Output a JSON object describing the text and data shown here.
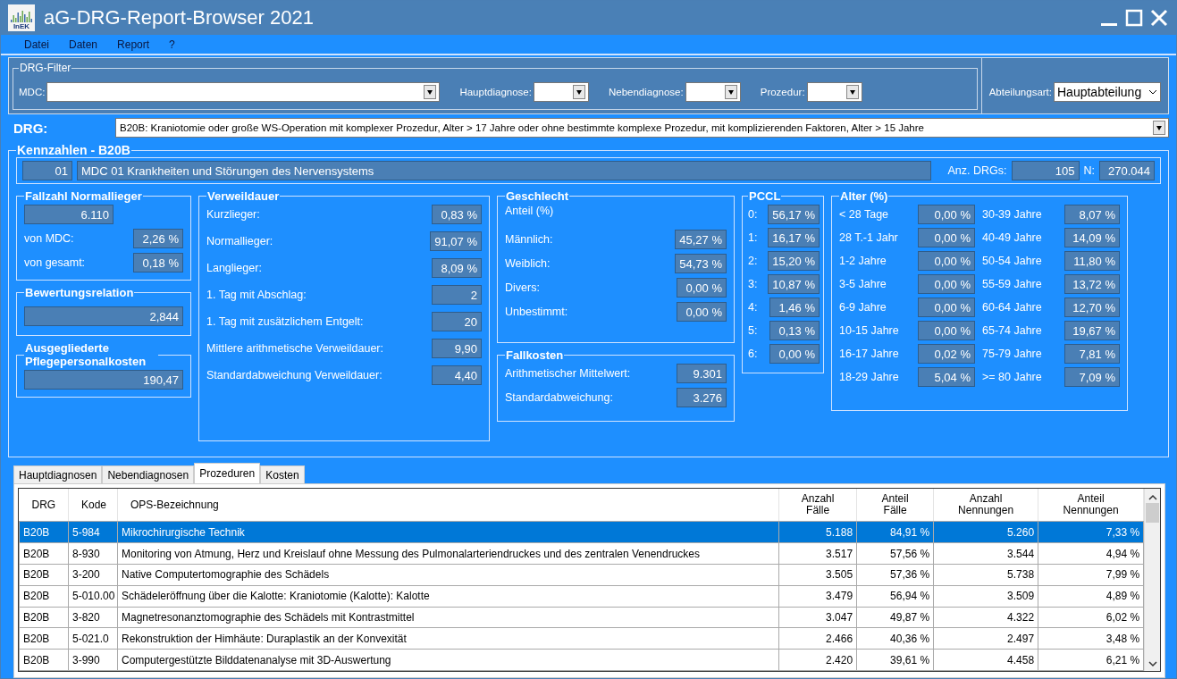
{
  "window": {
    "title": "aG-DRG-Report-Browser 2021",
    "logo_text": "InEK"
  },
  "menu": [
    "Datei",
    "Daten",
    "Report",
    "?"
  ],
  "filter": {
    "title": "DRG-Filter",
    "fields": [
      {
        "label": "MDC:",
        "kind": "combo"
      },
      {
        "label": "Hauptdiagnose:",
        "kind": "combo"
      },
      {
        "label": "Nebendiagnose:",
        "kind": "combo"
      },
      {
        "label": "Prozedur:",
        "kind": "combo"
      },
      {
        "label": "Abteilungsart:",
        "kind": "dropdown",
        "value": "Hauptabteilung"
      }
    ]
  },
  "drg": {
    "label": "DRG:",
    "value": "B20B: Kraniotomie oder große WS-Operation mit komplexer Prozedur, Alter > 17 Jahre oder ohne bestimmte komplexe Prozedur, mit komplizierenden Faktoren, Alter > 15 Jahre"
  },
  "kennzahlen": {
    "title": "Kennzahlen - B20B",
    "mdc_code": "01",
    "mdc_name": "MDC 01 Krankheiten und Störungen des Nervensystems",
    "anz_drgs_label": "Anz. DRGs:",
    "anz_drgs": "105",
    "n_label": "N:",
    "n": "270.044",
    "fallzahl": {
      "title": "Fallzahl Normallieger",
      "value": "6.110",
      "rows": [
        {
          "label": "von MDC:",
          "value": "2,26 %"
        },
        {
          "label": "von gesamt:",
          "value": "0,18 %"
        }
      ]
    },
    "bewertungsrelation": {
      "title": "Bewertungsrelation",
      "value": "2,844"
    },
    "pflege": {
      "title": "Ausgegliederte Pflegepersonalkosten",
      "value": "190,47"
    },
    "verweildauer": {
      "title": "Verweildauer",
      "rows": [
        {
          "label": "Kurzlieger:",
          "value": "0,83 %"
        },
        {
          "label": "Normallieger:",
          "value": "91,07 %"
        },
        {
          "label": "Langlieger:",
          "value": "8,09 %"
        },
        {
          "label": "1. Tag mit Abschlag:",
          "value": "2"
        },
        {
          "label": "1. Tag mit zusätzlichem Entgelt:",
          "value": "20"
        },
        {
          "label": "Mittlere arithmetische Verweildauer:",
          "value": "9,90"
        },
        {
          "label": "Standardabweichung Verweildauer:",
          "value": "4,40"
        }
      ]
    },
    "geschlecht": {
      "title": "Geschlecht",
      "subtitle": "Anteil (%)",
      "rows": [
        {
          "label": "Männlich:",
          "value": "45,27 %"
        },
        {
          "label": "Weiblich:",
          "value": "54,73 %"
        },
        {
          "label": "Divers:",
          "value": "0,00 %"
        },
        {
          "label": "Unbestimmt:",
          "value": "0,00 %"
        }
      ]
    },
    "fallkosten": {
      "title": "Fallkosten",
      "rows": [
        {
          "label": "Arithmetischer Mittelwert:",
          "value": "9.301"
        },
        {
          "label": "Standardabweichung:",
          "value": "3.276"
        }
      ]
    },
    "pccl": {
      "title": "PCCL",
      "rows": [
        {
          "label": "0:",
          "value": "56,17 %"
        },
        {
          "label": "1:",
          "value": "16,17 %"
        },
        {
          "label": "2:",
          "value": "15,20 %"
        },
        {
          "label": "3:",
          "value": "10,87 %"
        },
        {
          "label": "4:",
          "value": "1,46 %"
        },
        {
          "label": "5:",
          "value": "0,13 %"
        },
        {
          "label": "6:",
          "value": "0,00 %"
        }
      ]
    },
    "alter": {
      "title": "Alter (%)",
      "rows": [
        {
          "label": "< 28 Tage",
          "value": "0,00 %"
        },
        {
          "label": "30-39 Jahre",
          "value": "8,07 %"
        },
        {
          "label": "28 T.-1 Jahr",
          "value": "0,00 %"
        },
        {
          "label": "40-49 Jahre",
          "value": "14,09 %"
        },
        {
          "label": "1-2 Jahre",
          "value": "0,00 %"
        },
        {
          "label": "50-54 Jahre",
          "value": "11,80 %"
        },
        {
          "label": "3-5 Jahre",
          "value": "0,00 %"
        },
        {
          "label": "55-59 Jahre",
          "value": "13,72 %"
        },
        {
          "label": "6-9 Jahre",
          "value": "0,00 %"
        },
        {
          "label": "60-64 Jahre",
          "value": "12,70 %"
        },
        {
          "label": "10-15 Jahre",
          "value": "0,00 %"
        },
        {
          "label": "65-74 Jahre",
          "value": "19,67 %"
        },
        {
          "label": "16-17 Jahre",
          "value": "0,02 %"
        },
        {
          "label": "75-79 Jahre",
          "value": "7,81 %"
        },
        {
          "label": "18-29 Jahre",
          "value": "5,04 %"
        },
        {
          "label": ">= 80 Jahre",
          "value": "7,09 %"
        }
      ]
    }
  },
  "tabs": [
    {
      "label": "Hauptdiagnosen",
      "selected": false
    },
    {
      "label": "Nebendiagnosen",
      "selected": false
    },
    {
      "label": "Prozeduren",
      "selected": true
    },
    {
      "label": "Kosten",
      "selected": false
    }
  ],
  "table": {
    "columns": [
      "DRG",
      "Kode",
      "OPS-Bezeichnung",
      "Anzahl\nFälle",
      "Anteil\nFälle",
      "Anzahl\nNennungen",
      "Anteil\nNennungen"
    ],
    "rows": [
      {
        "selected": true,
        "cells": [
          "B20B",
          "5-984",
          "Mikrochirurgische Technik",
          "5.188",
          "84,91 %",
          "5.260",
          "7,33 %"
        ]
      },
      {
        "selected": false,
        "cells": [
          "B20B",
          "8-930",
          "Monitoring von Atmung, Herz und Kreislauf ohne Messung des Pulmonalarteriendruckes und des zentralen Venendruckes",
          "3.517",
          "57,56 %",
          "3.544",
          "4,94 %"
        ]
      },
      {
        "selected": false,
        "cells": [
          "B20B",
          "3-200",
          "Native Computertomographie des Schädels",
          "3.505",
          "57,36 %",
          "5.738",
          "7,99 %"
        ]
      },
      {
        "selected": false,
        "cells": [
          "B20B",
          "5-010.00",
          "Schädeleröffnung über die Kalotte: Kraniotomie (Kalotte): Kalotte",
          "3.479",
          "56,94 %",
          "3.509",
          "4,89 %"
        ]
      },
      {
        "selected": false,
        "cells": [
          "B20B",
          "3-820",
          "Magnetresonanztomographie des Schädels mit Kontrastmittel",
          "3.047",
          "49,87 %",
          "4.322",
          "6,02 %"
        ]
      },
      {
        "selected": false,
        "cells": [
          "B20B",
          "5-021.0",
          "Rekonstruktion der Himhäute: Duraplastik an der Konvexität",
          "2.466",
          "40,36 %",
          "2.497",
          "3,48 %"
        ]
      },
      {
        "selected": false,
        "cells": [
          "B20B",
          "3-990",
          "Computergestützte Bilddatenanalyse mit 3D-Auswertung",
          "2.420",
          "39,61 %",
          "4.458",
          "6,21 %"
        ]
      }
    ]
  }
}
